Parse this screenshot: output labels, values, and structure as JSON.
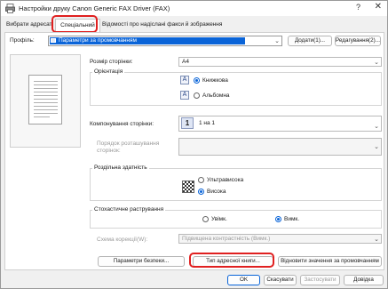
{
  "window": {
    "title": "Настройки друку Canon Generic FAX Driver (FAX)",
    "help": "?",
    "close": "✕"
  },
  "tabs": [
    {
      "label": "Вибрати адресат",
      "active": false
    },
    {
      "label": "Спеціальний",
      "active": true
    },
    {
      "label": "Відомості про надіслані факси й зображення",
      "active": false
    }
  ],
  "profile": {
    "label": "Профіль:",
    "value": "Параметри за промовчанням",
    "add_button": "Додати(1)...",
    "edit_button": "Редагування(2)..."
  },
  "form": {
    "page_size_label": "Розмір сторінки:",
    "page_size_value": "A4",
    "orientation": {
      "title": "Орієнтація",
      "portrait": "Книжкова",
      "landscape": "Альбомна",
      "selected": "portrait"
    },
    "layout_label": "Компонування сторінки:",
    "layout_icon": "1",
    "layout_value": "1 на 1",
    "page_order_label": "Порядок розташування сторінок:",
    "resolution": {
      "title": "Роздільна здатність",
      "option_ultra": "Ультрависока",
      "option_high": "Висока",
      "selected": "high"
    },
    "stochastic": {
      "title": "Стохастичне растрування",
      "option_on": "Увімк.",
      "option_off": "Вимк.",
      "selected": "off"
    },
    "correction_label": "Схема корекції(W):",
    "correction_value": "Підвищена контрастність (Вимк.)"
  },
  "bottom_buttons": {
    "security": "Параметри безпеки...",
    "address_type": "Тип адресної книги...",
    "restore_defaults": "Відновити значення за промовчанням"
  },
  "dialog_buttons": {
    "ok": "OK",
    "cancel": "Скасувати",
    "apply": "Застосувати",
    "help": "Довідка"
  },
  "colors": {
    "accent": "#0a64d8",
    "highlight": "#e02020"
  }
}
